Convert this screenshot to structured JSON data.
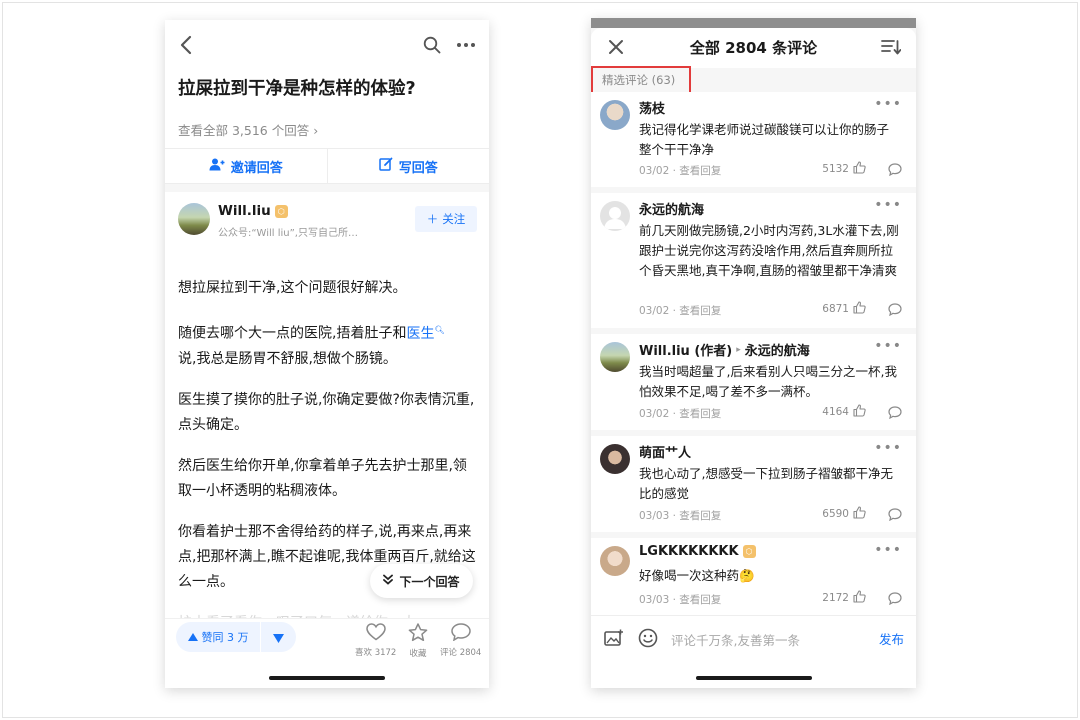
{
  "left": {
    "question": "拉屎拉到干净是种怎样的体验?",
    "view_all": "查看全部 3,516 个回答",
    "invite_label": "邀请回答",
    "write_label": "写回答",
    "author": {
      "name": "Will.liu",
      "desc": "公众号:“Will liu”,只写自己所…",
      "follow_label": "关注"
    },
    "paragraphs": [
      "想拉屎拉到干净,这个问题很好解决。",
      "说,我总是肠胃不舒服,想做个肠镜。",
      "医生摸了摸你的肚子说,你确定要做?你表情沉重,点头确定。",
      "然后医生给你开单,你拿着单子先去护士那里,领取一小杯透明的粘稠液体。",
      "你看着护士那不舍得给药的样子,说,再来点,再来点,把那杯满上,瞧不起谁呢,我体重两百斤,就给这么一点。"
    ],
    "para2_prefix": "随便去哪个大一点的医院,捂着肚子和",
    "para2_link": "医生",
    "faded_line": "护士看了看你，叹了口气，递给你一大",
    "next_answer_label": "下一个回答",
    "vote_label": "赞同 3 万",
    "like_label": "喜欢 3172",
    "collect_label": "收藏",
    "comment_label": "评论 2804"
  },
  "right": {
    "title": "全部 2804 条评论",
    "selected_label": "精选评论 (63)",
    "comments": [
      {
        "name": "荡枝",
        "text": "我记得化学课老师说过碳酸镁可以让你的肠子整个干干净净",
        "meta": "03/02 · 查看回复",
        "likes": "5132"
      },
      {
        "name": "永远的航海",
        "text": "前几天刚做完肠镜,2小时内泻药,3L水灌下去,刚跟护士说完你这泻药没啥作用,然后直奔厕所拉个昏天黑地,真干净啊,直肠的褶皱里都干净清爽",
        "meta": "03/02 · 查看回复",
        "likes": "6871"
      },
      {
        "name": "Will.liu (作者)",
        "reply_to": "永远的航海",
        "text": "我当时喝超量了,后来看别人只喝三分之一杯,我怕效果不足,喝了差不多一满杯。",
        "meta": "03/02 · 查看回复",
        "likes": "4164"
      },
      {
        "name": "萌面艹人",
        "text": "我也心动了,想感受一下拉到肠子褶皱都干净无比的感觉",
        "meta": "03/03 · 查看回复",
        "likes": "6590"
      },
      {
        "name": "LGKKKKKKKK",
        "text": "好像喝一次这种药🤔",
        "meta": "03/03 · 查看回复",
        "likes": "2172"
      }
    ],
    "input_placeholder": "评论千万条,友善第一条",
    "publish_label": "发布"
  },
  "colors": {
    "accent": "#1772f6",
    "highlight": "#e23b3b"
  },
  "icons": [
    "back-icon",
    "search-icon",
    "more-icon",
    "invite-icon",
    "edit-icon",
    "plus-icon",
    "double-chevron-down-icon",
    "vote-up-icon",
    "vote-down-icon",
    "heart-icon",
    "star-icon",
    "comment-icon",
    "close-icon",
    "sort-icon",
    "thumb-up-icon",
    "reply-icon",
    "image-icon",
    "emoji-icon"
  ]
}
